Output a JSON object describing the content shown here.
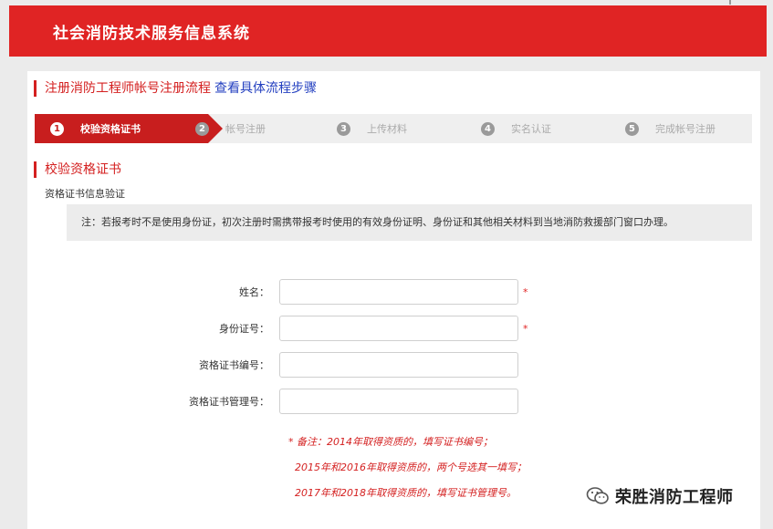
{
  "app": {
    "title": "社会消防技术服务信息系统"
  },
  "flow": {
    "title": "注册消防工程师帐号注册流程",
    "detail_link": "查看具体流程步骤"
  },
  "steps": [
    {
      "num": "1",
      "label": "校验资格证书",
      "active": true
    },
    {
      "num": "2",
      "label": "帐号注册",
      "active": false
    },
    {
      "num": "3",
      "label": "上传材料",
      "active": false
    },
    {
      "num": "4",
      "label": "实名认证",
      "active": false
    },
    {
      "num": "5",
      "label": "完成帐号注册",
      "active": false
    }
  ],
  "section": {
    "title": "校验资格证书",
    "subtitle": "资格证书信息验证",
    "notice": "注：若报考时不是使用身份证，初次注册时需携带报考时使用的有效身份证明、身份证和其他相关材料到当地消防救援部门窗口办理。"
  },
  "form": {
    "name_label": "姓名：",
    "name_value": "",
    "id_label": "身份证号：",
    "id_value": "",
    "cert_no_label": "资格证书编号：",
    "cert_no_value": "",
    "cert_mgmt_label": "资格证书管理号：",
    "cert_mgmt_value": "",
    "required_mark": "*"
  },
  "remarks": {
    "line1": "* 备注：2014年取得资质的，填写证书编号；",
    "line2": "2015年和2016年取得资质的，两个号选其一填写；",
    "line3": "2017年和2018年取得资质的，填写证书管理号。"
  },
  "watermark": {
    "text": "荣胜消防工程师",
    "icon": "wechat-icon"
  },
  "colors": {
    "brand_red": "#e02424",
    "active_step": "#c81e1e",
    "link_blue": "#2440c0"
  }
}
